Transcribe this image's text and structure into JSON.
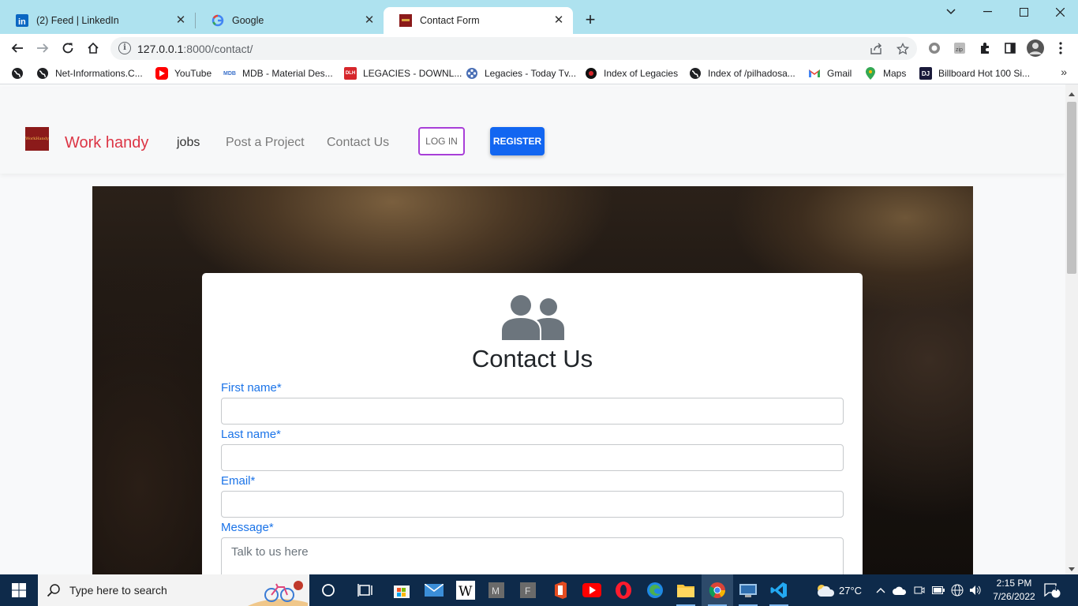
{
  "browser": {
    "tabs": [
      {
        "title": "(2) Feed | LinkedIn",
        "icon": "linkedin-icon",
        "active": false
      },
      {
        "title": "Google",
        "icon": "google-icon",
        "active": false
      },
      {
        "title": "Contact Form",
        "icon": "workhandy-favicon",
        "active": true
      }
    ],
    "url_host": "127.0.0.1",
    "url_path": ":8000/contact/",
    "bookmarks": [
      {
        "label": "Net-Informations.C...",
        "icon": "globe-icon"
      },
      {
        "label": "YouTube",
        "icon": "youtube-icon"
      },
      {
        "label": "MDB - Material Des...",
        "icon": "mdb-icon"
      },
      {
        "label": "LEGACIES - DOWNL...",
        "icon": "dlh-icon"
      },
      {
        "label": "Legacies - Today Tv...",
        "icon": "film-reel-icon"
      },
      {
        "label": "Index of Legacies",
        "icon": "spider-icon"
      },
      {
        "label": "Index of /pilhadosa...",
        "icon": "globe-icon"
      },
      {
        "label": "Gmail",
        "icon": "gmail-icon"
      },
      {
        "label": "Maps",
        "icon": "maps-icon"
      },
      {
        "label": "Billboard Hot 100 Si...",
        "icon": "dj-icon"
      }
    ],
    "bookmarks_more": "»"
  },
  "site": {
    "logo_text": "WorkHandy",
    "brand": "Work handy",
    "nav": [
      {
        "label": "jobs",
        "active": true
      },
      {
        "label": "Post a Project",
        "active": false
      },
      {
        "label": "Contact Us",
        "active": false
      }
    ],
    "login_label": "LOG IN",
    "register_label": "REGISTER",
    "colors": {
      "brand": "#dc3545",
      "register": "#1266f1",
      "login_border": "#a83fd8",
      "label": "#1a73e8"
    }
  },
  "contact": {
    "icon": "people-icon",
    "title": "Contact Us",
    "fields": {
      "first_name_label": "First name*",
      "first_name_value": "",
      "last_name_label": "Last name*",
      "last_name_value": "",
      "email_label": "Email*",
      "email_value": "",
      "message_label": "Message*",
      "message_placeholder": "Talk to us here"
    }
  },
  "taskbar": {
    "search_placeholder": "Type here to search",
    "weather": "27°C",
    "time": "2:15 PM",
    "date": "7/26/2022",
    "notification_count": "4"
  }
}
